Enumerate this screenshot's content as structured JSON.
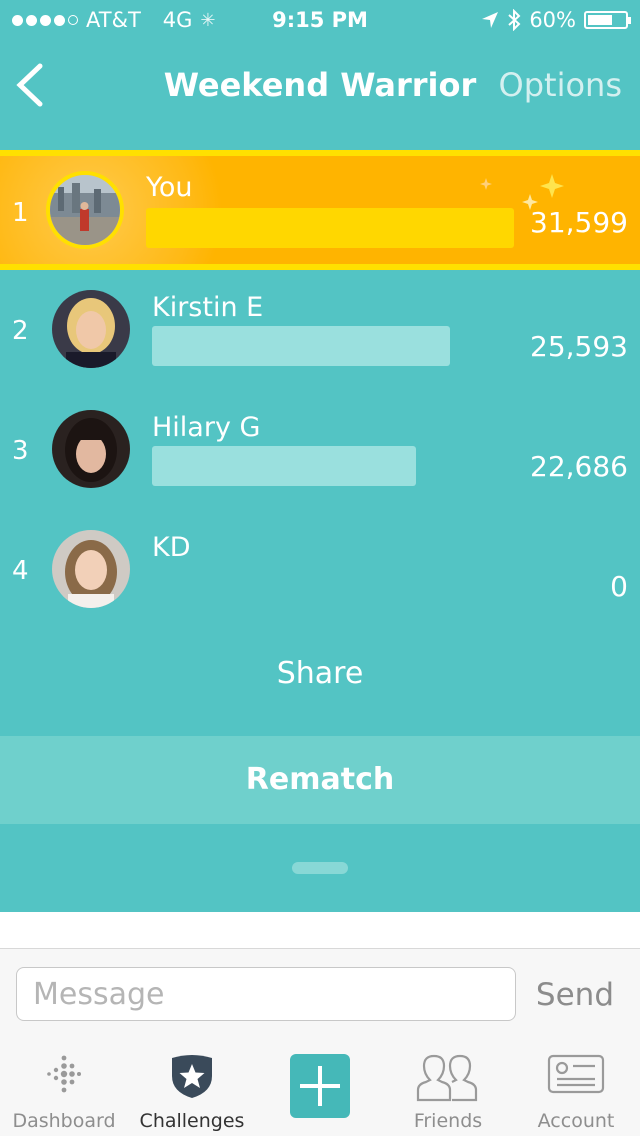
{
  "status_bar": {
    "carrier": "AT&T",
    "network": "4G",
    "time": "9:15 PM",
    "battery": "60%",
    "battery_level": 0.6
  },
  "nav": {
    "title": "Weekend Warrior",
    "options_label": "Options"
  },
  "leaderboard": [
    {
      "rank": "1",
      "name": "You",
      "steps": "31,599",
      "value": 31599
    },
    {
      "rank": "2",
      "name": "Kirstin E",
      "steps": "25,593",
      "value": 25593
    },
    {
      "rank": "3",
      "name": "Hilary G",
      "steps": "22,686",
      "value": 22686
    },
    {
      "rank": "4",
      "name": "KD",
      "steps": "0",
      "value": 0
    }
  ],
  "colors": {
    "background": "#53c4c4",
    "highlight": "#ffb400",
    "highlight_border": "#ffe000",
    "bar_you": "#ffd700",
    "bar_other": "#9ae0de",
    "tab_active_icon": "#3a4a5a",
    "add_button": "#45b8b8"
  },
  "share_label": "Share",
  "rematch_label": "Rematch",
  "message": {
    "placeholder": "Message",
    "value": "",
    "send_label": "Send"
  },
  "tabs": [
    {
      "label": "Dashboard",
      "icon": "dashboard-dots-icon"
    },
    {
      "label": "Challenges",
      "icon": "shield-star-icon",
      "active": true
    },
    {
      "label": "",
      "icon": "plus-icon"
    },
    {
      "label": "Friends",
      "icon": "friends-icon"
    },
    {
      "label": "Account",
      "icon": "id-card-icon"
    }
  ]
}
